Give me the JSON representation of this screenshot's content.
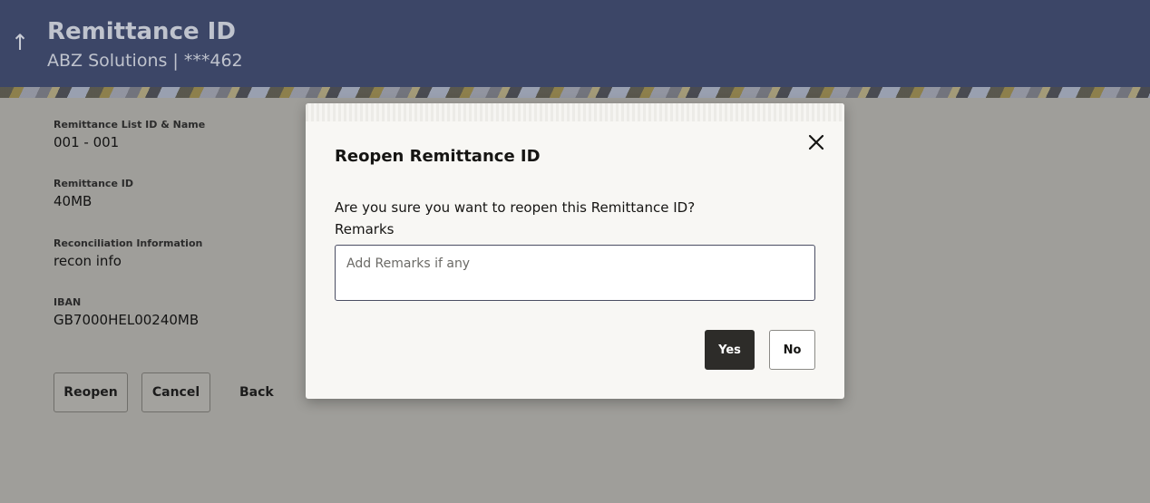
{
  "header": {
    "back_icon": "up-arrow-icon",
    "title": "Remittance ID",
    "subtitle": "ABZ Solutions | ***462"
  },
  "details": [
    {
      "label": "Remittance List ID & Name",
      "value": "001 - 001"
    },
    {
      "label": "Remittance ID",
      "value": "40MB"
    },
    {
      "label": "Reconciliation Information",
      "value": "recon info"
    },
    {
      "label": "IBAN",
      "value": "GB7000HEL00240MB"
    }
  ],
  "actions": {
    "reopen_label": "Reopen",
    "cancel_label": "Cancel",
    "back_label": "Back"
  },
  "modal": {
    "title": "Reopen Remittance ID",
    "close_icon": "close-icon",
    "question": "Are you sure you want to reopen this Remittance ID?",
    "remarks_label": "Remarks",
    "remarks_value": "",
    "remarks_placeholder": "Add Remarks if any",
    "yes_label": "Yes",
    "no_label": "No"
  },
  "colors": {
    "header_bg": "#3c4667",
    "overlay_bg": "#9f9e9a",
    "primary_button": "#2d2c29"
  }
}
